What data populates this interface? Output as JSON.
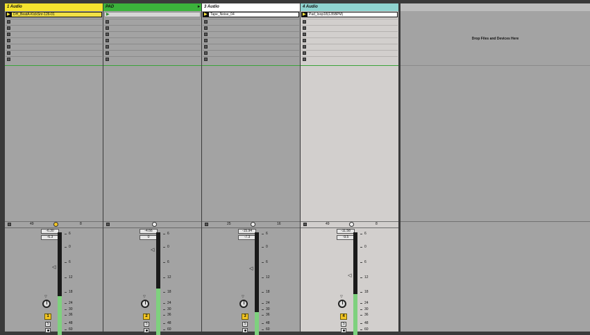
{
  "tracks": [
    {
      "name": "1 Audio",
      "color": "#f5e32e",
      "clip": "DH_BeatA-KickSnr-126-01",
      "clip_color": "#f0e045",
      "pan_left": "49",
      "pan_right": "8",
      "vol1": "-6.30",
      "vol2": "-6.3",
      "number": "1",
      "solo": "S",
      "meter_fill": 0.38,
      "fader_pos": 0.32
    },
    {
      "name": "PAD",
      "color": "#3bb23b",
      "clip": "",
      "clip_color": "",
      "pan_left": "",
      "pan_right": "",
      "vol1": "-4.66",
      "vol2": "0",
      "number": "2",
      "solo": "S",
      "meter_fill": 0.45,
      "fader_pos": 0.15
    },
    {
      "name": "3 Audio",
      "color": "#ffffff",
      "clip": "Tape_Noise_04",
      "clip_color": "#ffffff",
      "pan_left": "25",
      "pan_right": "16",
      "vol1": "-15.94",
      "vol2": "-7.3",
      "number": "3",
      "solo": "S",
      "meter_fill": 0.22,
      "fader_pos": 0.33
    },
    {
      "name": "4 Audio",
      "color": "#8fd3cf",
      "clip": "Pad_loop18(135BPM)",
      "clip_color": "#ffffff",
      "pan_left": "49",
      "pan_right": "8",
      "vol1": "-11.58",
      "vol2": "-9.5",
      "number": "4",
      "solo": "S",
      "meter_fill": 0.4,
      "fader_pos": 0.4
    }
  ],
  "scale": [
    "6",
    "0",
    "6",
    "12",
    "18",
    "24",
    "30",
    "36",
    "48",
    "60"
  ],
  "drop_label": "Drop Files and Devices Here"
}
